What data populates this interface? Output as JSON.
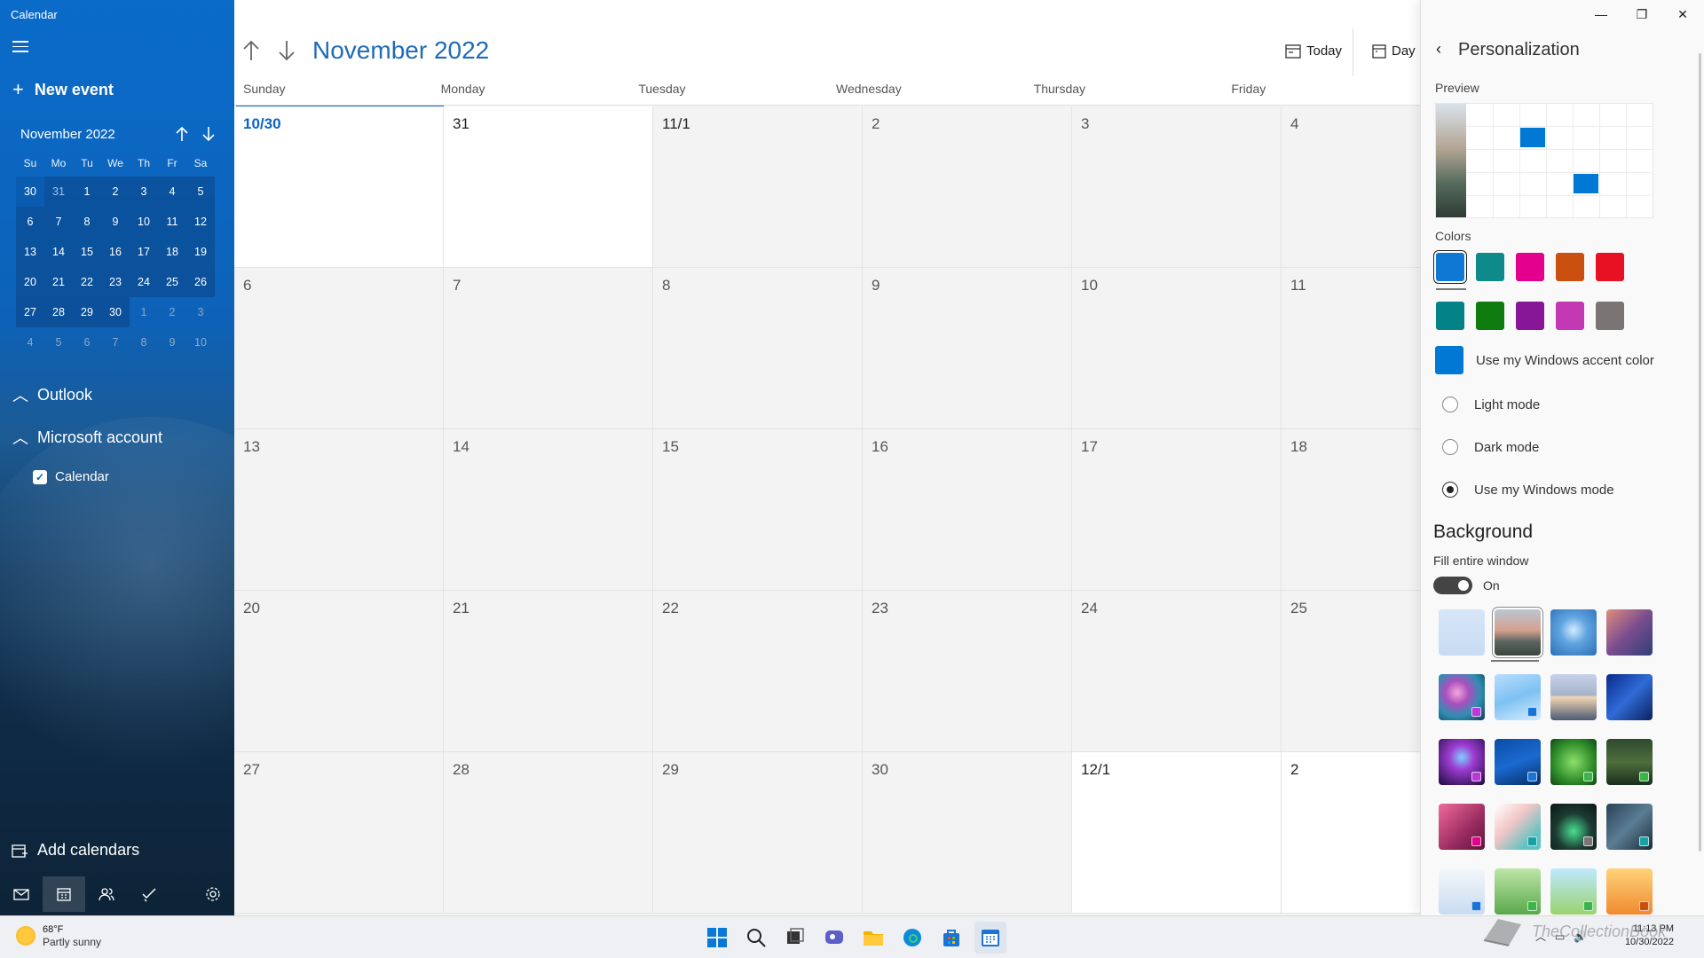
{
  "app": {
    "title": "Calendar"
  },
  "sidebar": {
    "new_event": "New event",
    "mini_calendar": {
      "month_label": "November 2022",
      "weekdays": [
        "Su",
        "Mo",
        "Tu",
        "We",
        "Th",
        "Fr",
        "Sa"
      ],
      "weeks": [
        [
          "30",
          "31",
          "1",
          "2",
          "3",
          "4",
          "5"
        ],
        [
          "6",
          "7",
          "8",
          "9",
          "10",
          "11",
          "12"
        ],
        [
          "13",
          "14",
          "15",
          "16",
          "17",
          "18",
          "19"
        ],
        [
          "20",
          "21",
          "22",
          "23",
          "24",
          "25",
          "26"
        ],
        [
          "27",
          "28",
          "29",
          "30",
          "1",
          "2",
          "3"
        ],
        [
          "4",
          "5",
          "6",
          "7",
          "8",
          "9",
          "10"
        ]
      ],
      "selected_day": "30"
    },
    "accounts": [
      {
        "label": "Outlook"
      },
      {
        "label": "Microsoft account"
      }
    ],
    "calendar_item": "Calendar",
    "add_calendars": "Add calendars",
    "bottom_nav_icons": [
      "mail-icon",
      "calendar-icon",
      "people-icon",
      "todo-icon",
      "settings-icon"
    ]
  },
  "main": {
    "month_title": "November 2022",
    "today_label": "Today",
    "day_label": "Day",
    "weekdays": [
      "Sunday",
      "Monday",
      "Tuesday",
      "Wednesday",
      "Thursday",
      "Friday"
    ],
    "weeks": [
      [
        "10/30",
        "31",
        "11/1",
        "2",
        "3",
        "4"
      ],
      [
        "6",
        "7",
        "8",
        "9",
        "10",
        "11"
      ],
      [
        "13",
        "14",
        "15",
        "16",
        "17",
        "18"
      ],
      [
        "20",
        "21",
        "22",
        "23",
        "24",
        "25"
      ],
      [
        "27",
        "28",
        "29",
        "30",
        "12/1",
        "2"
      ]
    ]
  },
  "personalization": {
    "title": "Personalization",
    "preview_label": "Preview",
    "colors_label": "Colors",
    "colors": [
      "#0f78d4",
      "#0e8a8a",
      "#e3008c",
      "#ca5010",
      "#e81123",
      "#038387",
      "#107c10",
      "#881798",
      "#c239b3",
      "#7a7574"
    ],
    "accent_label": "Use my Windows accent color",
    "accent_color": "#0078d4",
    "modes": [
      {
        "label": "Light mode",
        "selected": false
      },
      {
        "label": "Dark mode",
        "selected": false
      },
      {
        "label": "Use my Windows mode",
        "selected": true
      }
    ],
    "background_title": "Background",
    "fill_label": "Fill entire window",
    "fill_state": "On"
  },
  "taskbar": {
    "temperature": "68°F",
    "condition": "Partly sunny",
    "time": "11:13 PM",
    "date": "10/30/2022"
  },
  "watermark": "TheCollectionBook"
}
